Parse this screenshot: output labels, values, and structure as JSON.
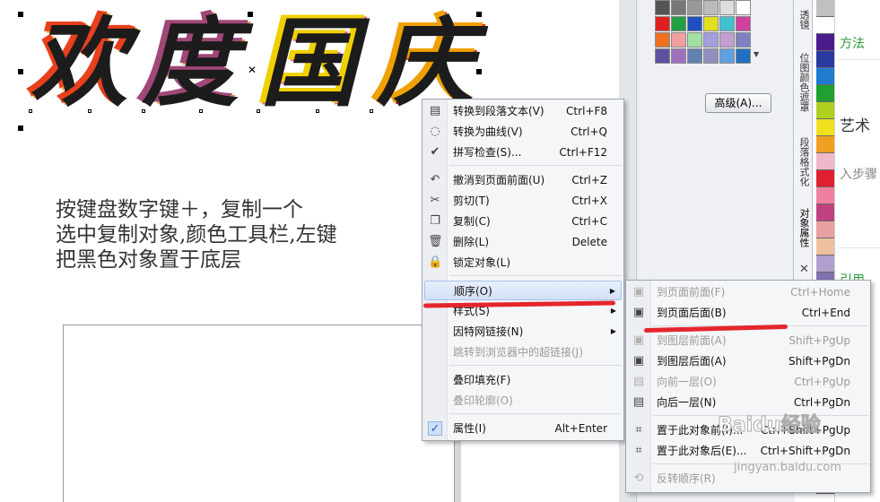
{
  "canvas": {
    "art_title": [
      "欢",
      "度",
      "国",
      "庆"
    ],
    "instructions": "按键盘数字键＋，复制一个\n选中复制对象,颜色工具栏,左键\n把黑色对象置于底层"
  },
  "docker": {
    "swatches": [
      "#555555",
      "#777777",
      "#999999",
      "#bbbbbb",
      "#dddddd",
      "#ffffff",
      "#e02020",
      "#20a040",
      "#2050c0",
      "#e0e020",
      "#40c0d0",
      "#d040a0",
      "#f07020",
      "#f0a0a0",
      "#a0e0a0",
      "#a0a0e0",
      "#c0a0d0",
      "#8080c0",
      "#6050a0",
      "#a070c0",
      "#6080b0",
      "#9090c0",
      "#60a0e0",
      "#2070c0"
    ],
    "advanced_button": "高级(A)...",
    "tabs": [
      "透镜",
      "位图颜色遮罩",
      "段落格式化",
      "对象属性"
    ],
    "palette": [
      "#c0c0c0",
      "#ffffff",
      "#4a1c8c",
      "#2a3aa0",
      "#1f7ad0",
      "#20a030",
      "#b0d020",
      "#f0e020",
      "#f0a020",
      "#f0b8c8",
      "#e02030",
      "#f080a0",
      "#c04080",
      "#e8a0a0",
      "#f0c0a0",
      "#b0a0d0",
      "#8070b0",
      "#6a5aa0",
      "#a090c0",
      "#6060a0",
      "#404080",
      "#a0c0e0",
      "#80a0c0",
      "#6090b0",
      "#4080a0",
      "#209090",
      "#107070",
      "#006060",
      "#004848"
    ],
    "edge_texts": [
      "方法",
      "艺术",
      "入步骤",
      "引用"
    ]
  },
  "context_menu": {
    "items": [
      {
        "icon": "paragraph-text-icon",
        "glyph": "▤",
        "label": "转换到段落文本(V)",
        "shortcut": "Ctrl+F8"
      },
      {
        "icon": "curve-icon",
        "glyph": "◌",
        "label": "转换为曲线(V)",
        "shortcut": "Ctrl+Q"
      },
      {
        "icon": "spellcheck-icon",
        "glyph": "✔",
        "label": "拼写检查(S)...",
        "shortcut": "Ctrl+F12"
      },
      {
        "icon": "undo-icon",
        "glyph": "↶",
        "label": "撤消到页面前面(U)",
        "shortcut": "Ctrl+Z"
      },
      {
        "icon": "cut-icon",
        "glyph": "✂",
        "label": "剪切(T)",
        "shortcut": "Ctrl+X"
      },
      {
        "icon": "copy-icon",
        "glyph": "❐",
        "label": "复制(C)",
        "shortcut": "Ctrl+C"
      },
      {
        "icon": "delete-icon",
        "glyph": "🗑",
        "label": "删除(L)",
        "shortcut": "Delete"
      },
      {
        "icon": "lock-icon",
        "glyph": "🔒",
        "label": "锁定对象(L)",
        "shortcut": ""
      },
      {
        "icon": "",
        "glyph": "",
        "label": "顺序(O)",
        "shortcut": ""
      },
      {
        "icon": "",
        "glyph": "",
        "label": "样式(S)",
        "shortcut": ""
      },
      {
        "icon": "",
        "glyph": "",
        "label": "因特网链接(N)",
        "shortcut": ""
      },
      {
        "icon": "",
        "glyph": "",
        "label": "跳转到浏览器中的超链接(J)",
        "shortcut": ""
      },
      {
        "icon": "",
        "glyph": "",
        "label": "叠印填充(F)",
        "shortcut": ""
      },
      {
        "icon": "",
        "glyph": "",
        "label": "叠印轮廓(O)",
        "shortcut": ""
      },
      {
        "icon": "check-icon",
        "glyph": "✓",
        "label": "属性(I)",
        "shortcut": "Alt+Enter"
      }
    ]
  },
  "order_submenu": {
    "items": [
      {
        "label": "到页面前面(F)",
        "shortcut": "Ctrl+Home"
      },
      {
        "label": "到页面后面(B)",
        "shortcut": "Ctrl+End"
      },
      {
        "label": "到图层前面(A)",
        "shortcut": "Shift+PgUp"
      },
      {
        "label": "到图层后面(A)",
        "shortcut": "Shift+PgDn"
      },
      {
        "label": "向前一层(O)",
        "shortcut": "Ctrl+PgUp"
      },
      {
        "label": "向后一层(N)",
        "shortcut": "Ctrl+PgDn"
      },
      {
        "label": "置于此对象前(I)...",
        "shortcut": "Ctrl+Shift+PgUp"
      },
      {
        "label": "置于此对象后(E)...",
        "shortcut": "Ctrl+Shift+PgDn"
      },
      {
        "label": "反转顺序(R)",
        "shortcut": ""
      }
    ]
  },
  "watermark": {
    "text": "Baidu经验",
    "url": "jingyan.baidu.com"
  },
  "colors": {
    "highlight_stroke": "#e4252c",
    "menu_highlight": "#d2e0f6"
  }
}
